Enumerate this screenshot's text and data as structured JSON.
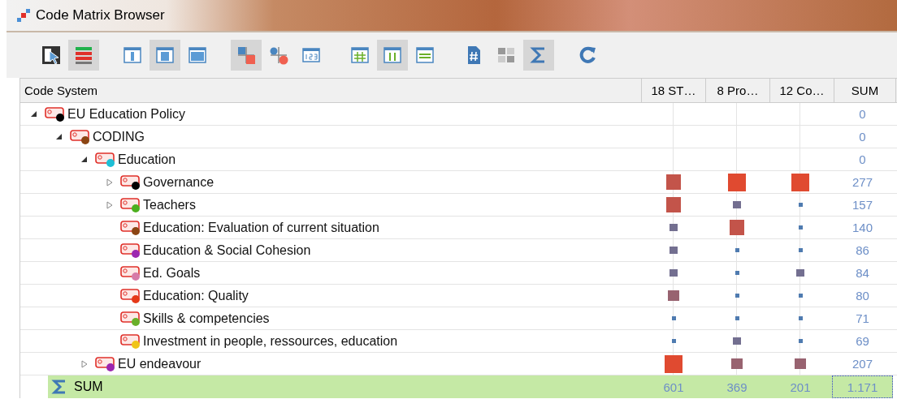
{
  "window": {
    "title": "Code Matrix Browser"
  },
  "toolbar": {
    "groups": [
      {
        "buttons": [
          {
            "kind": "select",
            "selected": false
          },
          {
            "kind": "stack",
            "selected": true
          }
        ]
      },
      {
        "buttons": [
          {
            "kind": "narrow",
            "selected": false
          },
          {
            "kind": "medium",
            "selected": true
          },
          {
            "kind": "wide",
            "selected": false
          }
        ]
      },
      {
        "buttons": [
          {
            "kind": "squares",
            "selected": true
          },
          {
            "kind": "circles",
            "selected": false
          },
          {
            "kind": "numbers",
            "selected": false
          }
        ]
      },
      {
        "buttons": [
          {
            "kind": "hash",
            "selected": false
          },
          {
            "kind": "columns",
            "selected": true
          },
          {
            "kind": "lines",
            "selected": false
          }
        ]
      },
      {
        "buttons": [
          {
            "kind": "document",
            "selected": false
          },
          {
            "kind": "ones",
            "selected": false
          },
          {
            "kind": "sigma",
            "selected": true
          }
        ]
      },
      {
        "buttons": [
          {
            "kind": "refresh",
            "selected": false
          }
        ]
      }
    ]
  },
  "table": {
    "columns": [
      {
        "label": "Code System"
      },
      {
        "label": "18 ST…"
      },
      {
        "label": "8 Pro…"
      },
      {
        "label": "12 Co…"
      },
      {
        "label": "SUM"
      }
    ],
    "tree": [
      {
        "label": "EU Education Policy",
        "color": "#000000",
        "expanded": true,
        "sum": "0",
        "children": [
          {
            "label": "CODING",
            "color": "#8b4513",
            "expanded": true,
            "sum": "0",
            "children": [
              {
                "label": "Education",
                "color": "#1ebfd6",
                "expanded": true,
                "sum": "0",
                "children": [
                  {
                    "label": "Governance",
                    "color": "#000000",
                    "expanded": false,
                    "sum": "277",
                    "cells": [
                      {
                        "kind": "large"
                      },
                      {
                        "kind": "full"
                      },
                      {
                        "kind": "full"
                      }
                    ]
                  },
                  {
                    "label": "Teachers",
                    "color": "#4caf1e",
                    "expanded": false,
                    "sum": "157",
                    "cells": [
                      {
                        "kind": "large"
                      },
                      {
                        "kind": "small"
                      },
                      {
                        "kind": "dot"
                      }
                    ]
                  },
                  {
                    "label": "Education: Evaluation of current situation",
                    "color": "#8b4513",
                    "sum": "140",
                    "cells": [
                      {
                        "kind": "small"
                      },
                      {
                        "kind": "large"
                      },
                      {
                        "kind": "dot"
                      }
                    ]
                  },
                  {
                    "label": "Education & Social Cohesion",
                    "color": "#9c27b0",
                    "sum": "86",
                    "cells": [
                      {
                        "kind": "small"
                      },
                      {
                        "kind": "dot"
                      },
                      {
                        "kind": "dot"
                      }
                    ]
                  },
                  {
                    "label": "Ed. Goals",
                    "color": "#d67aa8",
                    "sum": "84",
                    "cells": [
                      {
                        "kind": "small"
                      },
                      {
                        "kind": "dot"
                      },
                      {
                        "kind": "small"
                      }
                    ]
                  },
                  {
                    "label": "Education: Quality",
                    "color": "#e53919",
                    "sum": "80",
                    "cells": [
                      {
                        "kind": "medium"
                      },
                      {
                        "kind": "dot"
                      },
                      {
                        "kind": "dot"
                      }
                    ]
                  },
                  {
                    "label": "Skills & competencies",
                    "color": "#6ab02a",
                    "sum": "71",
                    "cells": [
                      {
                        "kind": "dot"
                      },
                      {
                        "kind": "dot"
                      },
                      {
                        "kind": "dot"
                      }
                    ]
                  },
                  {
                    "label": "Investment in people, ressources, education",
                    "color": "#f0c419",
                    "sum": "69",
                    "cells": [
                      {
                        "kind": "dot"
                      },
                      {
                        "kind": "small"
                      },
                      {
                        "kind": "dot"
                      }
                    ]
                  }
                ]
              },
              {
                "label": "EU endeavour",
                "color": "#9c27b0",
                "expanded": false,
                "sum": "207",
                "cells": [
                  {
                    "kind": "full"
                  },
                  {
                    "kind": "medium"
                  },
                  {
                    "kind": "medium"
                  }
                ]
              }
            ]
          }
        ]
      }
    ],
    "sum_row": {
      "label": "SUM",
      "values": [
        "601",
        "369",
        "201"
      ],
      "total": "1.171"
    }
  }
}
